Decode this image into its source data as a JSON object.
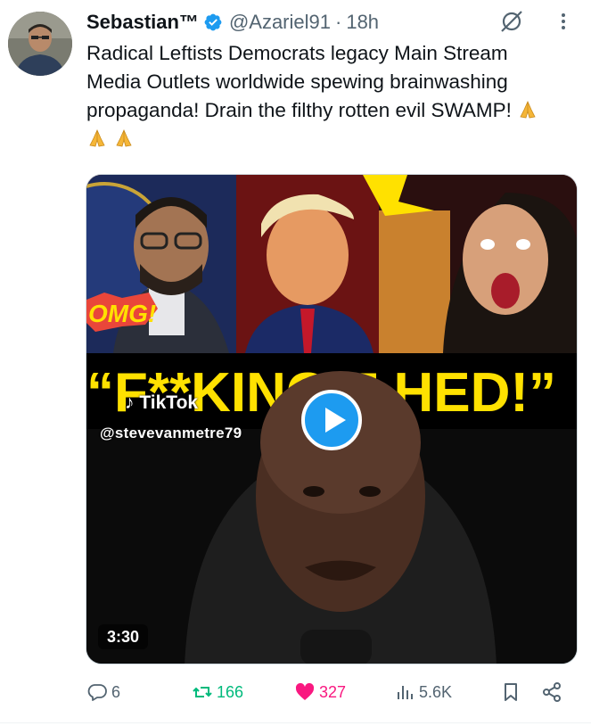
{
  "tweet": {
    "display_name": "Sebastian™",
    "handle": "@Azariel91",
    "separator": "·",
    "time": "18h",
    "text": "Radical Leftists Democrats legacy Main Stream Media Outlets worldwide spewing brainwashing propaganda! Drain the filthy rotten evil SWAMP!",
    "emojis": [
      "folded-hands-emoji",
      "folded-hands-emoji",
      "folded-hands-emoji"
    ]
  },
  "media": {
    "overlay_omg": "OMG!",
    "overlay_headline": "“F**KING F   HED!”",
    "tiktok_logo": "TikTok",
    "tiktok_handle": "@stevevanmetre79",
    "duration": "3:30",
    "icons": [
      "play-icon",
      "tiktok-icon"
    ]
  },
  "actions": {
    "replies": "6",
    "reposts": "166",
    "likes": "327",
    "views": "5.6K"
  },
  "colors": {
    "verified_blue": "#1d9bf0",
    "repost_green": "#00ba7c",
    "like_pink": "#f91880",
    "muted_gray": "#536471",
    "headline_yellow": "#ffe100"
  }
}
